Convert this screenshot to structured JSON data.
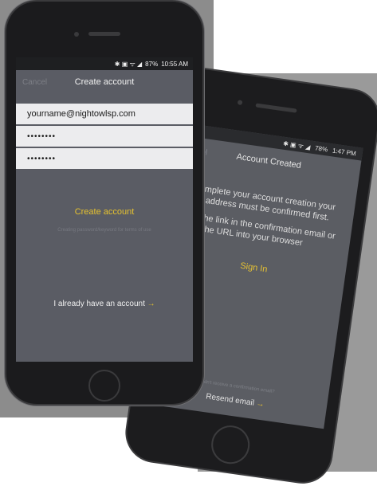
{
  "front_phone": {
    "status": {
      "icons": "✱ ▣ ᯤ ◢",
      "battery": "87%",
      "time": "10:55 AM"
    },
    "nav": {
      "left": "Cancel",
      "title": "Create account"
    },
    "email_value": "yourname@nightowlsp.com",
    "password_value": "••••••••",
    "confirm_value": "••••••••",
    "create_label": "Create account",
    "hint": "Creating password/keyword for terms of use",
    "already_label": "I already have an account",
    "arrow": "→"
  },
  "back_phone": {
    "status": {
      "icons": "✱ ▣ ᯤ ◢",
      "battery": "78%",
      "time": "1:47 PM"
    },
    "nav": {
      "left": "Cancel",
      "title": "Account Created"
    },
    "message1": "To complete your account creation your email address must be confirmed first.",
    "message2": "Click the link in the confirmation email or paste the URL into your browser",
    "signin_label": "Sign In",
    "hint": "Didn't receive a confirmation email?",
    "resend_label": "Resend email",
    "arrow": "→"
  }
}
